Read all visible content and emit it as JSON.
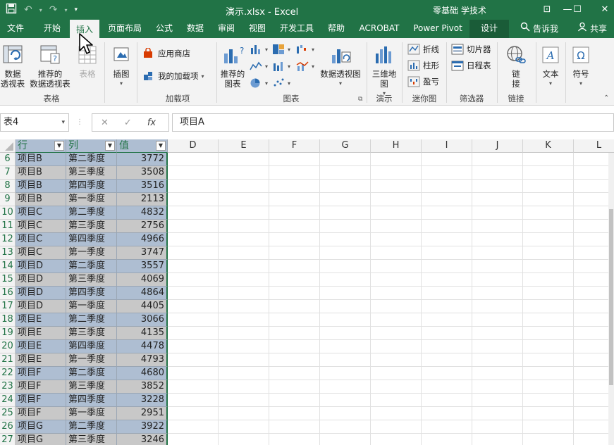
{
  "titlebar": {
    "title": "演示.xlsx  -  Excel",
    "user": "零基础 学技术",
    "save_icon": "save-icon",
    "undo_icon": "undo-icon",
    "redo_icon": "redo-icon",
    "minimize": "—",
    "restore": "☐",
    "close": "✕",
    "ribbon_display": "⊡"
  },
  "tabs": [
    {
      "label": "文件"
    },
    {
      "label": "开始"
    },
    {
      "label": "插入"
    },
    {
      "label": "页面布局"
    },
    {
      "label": "公式"
    },
    {
      "label": "数据"
    },
    {
      "label": "审阅"
    },
    {
      "label": "视图"
    },
    {
      "label": "开发工具"
    },
    {
      "label": "帮助"
    },
    {
      "label": "ACROBAT"
    },
    {
      "label": "Power Pivot"
    },
    {
      "label": "设计"
    }
  ],
  "tell_me": "告诉我",
  "share": "共享",
  "ribbon": {
    "tables": {
      "pivot_line1": "数据",
      "pivot_line2": "透视表",
      "recommended_line1": "推荐的",
      "recommended_line2": "数据透视表",
      "table": "表格",
      "group": "表格"
    },
    "illustrations": {
      "label": "插图"
    },
    "addins": {
      "store": "应用商店",
      "my_addins": "我的加载项",
      "group": "加载项"
    },
    "charts": {
      "recommended_line1": "推荐的",
      "recommended_line2": "图表",
      "pivot_chart": "数据透视图",
      "group": "图表"
    },
    "tours": {
      "map_line1": "三维地",
      "map_line2": "图",
      "group": "演示"
    },
    "sparklines": {
      "line": "折线",
      "column": "柱形",
      "winloss": "盈亏",
      "group": "迷你图"
    },
    "filters": {
      "slicer": "切片器",
      "timeline": "日程表",
      "group": "筛选器"
    },
    "links": {
      "link_line1": "链",
      "link_line2": "接",
      "group": "链接"
    },
    "text": {
      "label": "文本"
    },
    "symbols": {
      "label": "符号"
    }
  },
  "formula_bar": {
    "name_box": "表4",
    "cancel": "✕",
    "enter": "✓",
    "fx": "fx",
    "content": "项目A"
  },
  "columns": [
    "行",
    "列",
    "值",
    "D",
    "E",
    "F",
    "G",
    "H",
    "I",
    "J",
    "K",
    "L"
  ],
  "rows": [
    {
      "n": "6",
      "a": "项目B",
      "b": "第二季度",
      "c": "3772"
    },
    {
      "n": "7",
      "a": "项目B",
      "b": "第三季度",
      "c": "3508"
    },
    {
      "n": "8",
      "a": "项目B",
      "b": "第四季度",
      "c": "3516"
    },
    {
      "n": "9",
      "a": "项目B",
      "b": "第一季度",
      "c": "2113"
    },
    {
      "n": "10",
      "a": "项目C",
      "b": "第二季度",
      "c": "4832"
    },
    {
      "n": "11",
      "a": "项目C",
      "b": "第三季度",
      "c": "2756"
    },
    {
      "n": "12",
      "a": "项目C",
      "b": "第四季度",
      "c": "4966"
    },
    {
      "n": "13",
      "a": "项目C",
      "b": "第一季度",
      "c": "3747"
    },
    {
      "n": "14",
      "a": "项目D",
      "b": "第二季度",
      "c": "3557"
    },
    {
      "n": "15",
      "a": "项目D",
      "b": "第三季度",
      "c": "4069"
    },
    {
      "n": "16",
      "a": "项目D",
      "b": "第四季度",
      "c": "4864"
    },
    {
      "n": "17",
      "a": "项目D",
      "b": "第一季度",
      "c": "4405"
    },
    {
      "n": "18",
      "a": "项目E",
      "b": "第二季度",
      "c": "3066"
    },
    {
      "n": "19",
      "a": "项目E",
      "b": "第三季度",
      "c": "4135"
    },
    {
      "n": "20",
      "a": "项目E",
      "b": "第四季度",
      "c": "4478"
    },
    {
      "n": "21",
      "a": "项目E",
      "b": "第一季度",
      "c": "4793"
    },
    {
      "n": "22",
      "a": "项目F",
      "b": "第二季度",
      "c": "4680"
    },
    {
      "n": "23",
      "a": "项目F",
      "b": "第三季度",
      "c": "3852"
    },
    {
      "n": "24",
      "a": "项目F",
      "b": "第四季度",
      "c": "3228"
    },
    {
      "n": "25",
      "a": "项目F",
      "b": "第一季度",
      "c": "2951"
    },
    {
      "n": "26",
      "a": "项目G",
      "b": "第二季度",
      "c": "3922"
    },
    {
      "n": "27",
      "a": "项目G",
      "b": "第三季度",
      "c": "3246"
    }
  ],
  "colors": {
    "excel_green": "#217346",
    "table_blue": "#aebed2",
    "table_gray": "#c8c8c8"
  }
}
